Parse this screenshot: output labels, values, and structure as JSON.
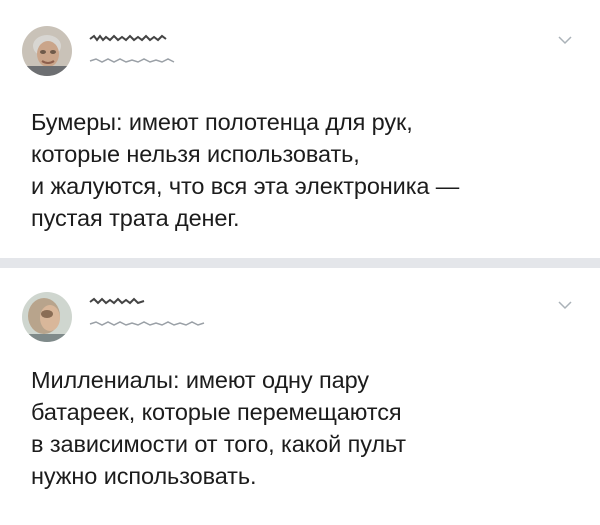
{
  "posts": [
    {
      "lines": [
        "Бумеры: имеют полотенца для рук,",
        "которые нельзя использовать,",
        "и жалуются, что вся эта электроника —",
        "пустая трата денег."
      ],
      "avatar_icon": "user-avatar",
      "menu_icon": "chevron-down-icon"
    },
    {
      "lines": [
        "Миллениалы: имеют одну пару",
        "батареек, которые перемещаются",
        "в зависимости от того, какой пульт",
        "нужно использовать."
      ],
      "avatar_icon": "user-avatar",
      "menu_icon": "chevron-down-icon"
    }
  ],
  "colors": {
    "text": "#1c1c1c",
    "divider": "#e4e6ea",
    "chevron": "#aab2b8",
    "redacted": "#9aa0a6"
  }
}
